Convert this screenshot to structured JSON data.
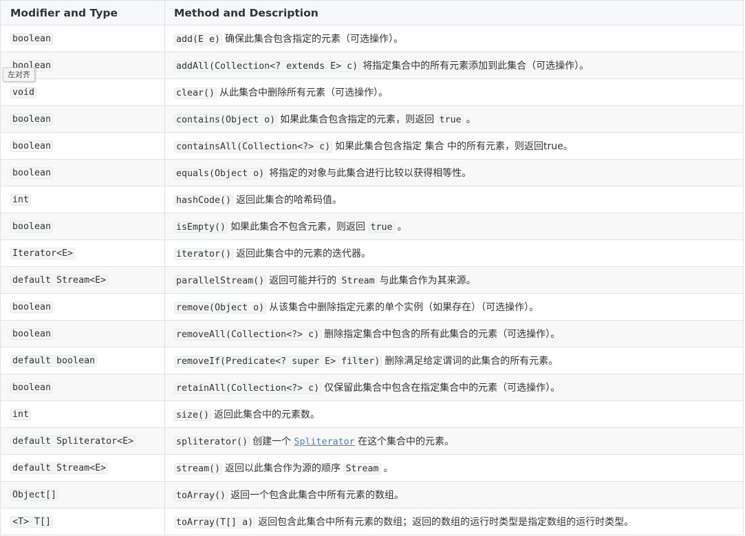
{
  "table": {
    "header": {
      "col1": "Modifier and Type",
      "col2": "Method and Description"
    },
    "rows": [
      {
        "type": "boolean",
        "method": "add(E e)",
        "desc": "确保此集合包含指定的元素（可选操作）。"
      },
      {
        "type": "boolean",
        "method": "addAll(Collection<? extends E> c)",
        "desc": "将指定集合中的所有元素添加到此集合（可选操作）。"
      },
      {
        "type": "void",
        "method": "clear()",
        "desc": "从此集合中删除所有元素（可选操作）。"
      },
      {
        "type": "boolean",
        "method": "contains(Object o)",
        "desc": "如果此集合包含指定的元素，则返回",
        "code2": "true",
        "desc2": "。"
      },
      {
        "type": "boolean",
        "method": "containsAll(Collection<?> c)",
        "desc": "如果此集合包含指定 集合 中的所有元素，则返回true。"
      },
      {
        "type": "boolean",
        "method": "equals(Object o)",
        "desc": "将指定的对象与此集合进行比较以获得相等性。"
      },
      {
        "type": "int",
        "method": "hashCode()",
        "desc": "返回此集合的哈希码值。"
      },
      {
        "type": "boolean",
        "method": "isEmpty()",
        "desc": "如果此集合不包含元素，则返回",
        "code2": "true",
        "desc2": "。"
      },
      {
        "type": "Iterator<E>",
        "method": "iterator()",
        "desc": "返回此集合中的元素的迭代器。"
      },
      {
        "type": "default Stream<E>",
        "method": "parallelStream()",
        "desc": "返回可能并行的",
        "code2": "Stream",
        "desc2": "与此集合作为其来源。"
      },
      {
        "type": "boolean",
        "method": "remove(Object o)",
        "desc": "从该集合中删除指定元素的单个实例（如果存在）（可选操作）。"
      },
      {
        "type": "boolean",
        "method": "removeAll(Collection<?> c)",
        "desc": "删除指定集合中包含的所有此集合的元素（可选操作）。"
      },
      {
        "type": "default boolean",
        "method": "removeIf(Predicate<? super E> filter)",
        "desc": "删除满足给定谓词的此集合的所有元素。"
      },
      {
        "type": "boolean",
        "method": "retainAll(Collection<?> c)",
        "desc": "仅保留此集合中包含在指定集合中的元素（可选操作）。"
      },
      {
        "type": "int",
        "method": "size()",
        "desc": "返回此集合中的元素数。"
      },
      {
        "type": "default Spliterator<E>",
        "method": "spliterator()",
        "desc": "创建一个",
        "link": "Spliterator",
        "desc2": "在这个集合中的元素。"
      },
      {
        "type": "default Stream<E>",
        "method": "stream()",
        "desc": "返回以此集合作为源的顺序",
        "code2": "Stream",
        "desc2": "。"
      },
      {
        "type": "Object[]",
        "method": "toArray()",
        "desc": "返回一个包含此集合中所有元素的数组。"
      },
      {
        "type": "<T> T[]",
        "method": "toArray(T[] a)",
        "desc": "返回包含此集合中所有元素的数组；返回的数组的运行时类型是指定数组的运行时类型。"
      }
    ]
  },
  "tooltip": {
    "text": "左对齐"
  }
}
